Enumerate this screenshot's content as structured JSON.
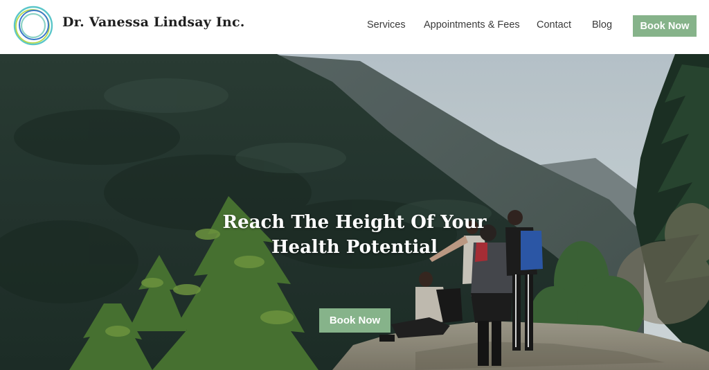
{
  "header": {
    "brand": "Dr. Vanessa Lindsay Inc.",
    "nav": [
      {
        "label": "Services"
      },
      {
        "label": "Appointments & Fees"
      },
      {
        "label": "Contact"
      },
      {
        "label": "Blog"
      }
    ],
    "book_button": "Book Now"
  },
  "hero": {
    "title_line1": "Reach The Height Of Your",
    "title_line2": "Health Potential",
    "book_button": "Book Now"
  },
  "colors": {
    "accent": "#86b38a",
    "logo_rings": [
      "#5bc6c9",
      "#8cd3c5",
      "#3a78c9",
      "#b8d94a"
    ]
  }
}
